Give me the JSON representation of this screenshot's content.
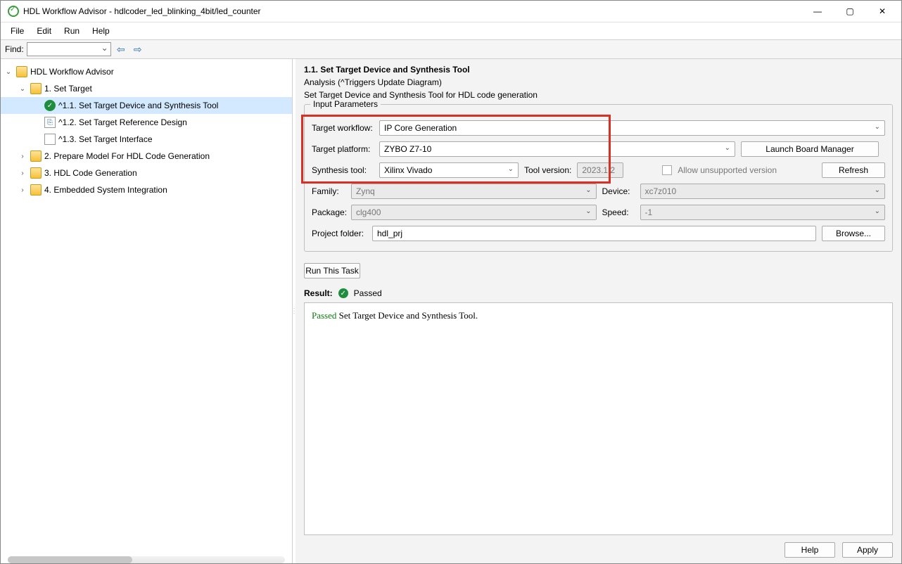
{
  "window": {
    "title": "HDL Workflow Advisor - hdlcoder_led_blinking_4bit/led_counter"
  },
  "menu": {
    "file": "File",
    "edit": "Edit",
    "run": "Run",
    "help": "Help"
  },
  "find": {
    "label": "Find:"
  },
  "tree": {
    "root": "HDL Workflow Advisor",
    "n1": "1. Set Target",
    "n11": "^1.1. Set Target Device and Synthesis Tool",
    "n12": "^1.2. Set Target Reference Design",
    "n13": "^1.3. Set Target Interface",
    "n2": "2. Prepare Model For HDL Code Generation",
    "n3": "3. HDL Code Generation",
    "n4": "4. Embedded System Integration"
  },
  "panel": {
    "heading": "1.1. Set Target Device and Synthesis Tool",
    "subtitle": "Analysis (^Triggers Update Diagram)",
    "desc": "Set Target Device and Synthesis Tool for HDL code generation",
    "legend": "Input Parameters",
    "labels": {
      "workflow": "Target workflow:",
      "platform": "Target platform:",
      "synthesis": "Synthesis tool:",
      "toolversion": "Tool version:",
      "family": "Family:",
      "device": "Device:",
      "package": "Package:",
      "speed": "Speed:",
      "project": "Project folder:",
      "allow": "Allow unsupported version"
    },
    "values": {
      "workflow": "IP Core Generation",
      "platform": "ZYBO Z7-10",
      "synthesis": "Xilinx Vivado",
      "toolversion": "2023.1.2",
      "family": "Zynq",
      "device": "xc7z010",
      "package": "clg400",
      "speed": "-1",
      "project": "hdl_prj"
    },
    "buttons": {
      "boardmgr": "Launch Board Manager",
      "refresh": "Refresh",
      "browse": "Browse...",
      "runtask": "Run This Task",
      "help": "Help",
      "apply": "Apply"
    },
    "result": {
      "label": "Result:",
      "status": "Passed",
      "passed_word": "Passed",
      "message": " Set Target Device and Synthesis Tool."
    }
  }
}
